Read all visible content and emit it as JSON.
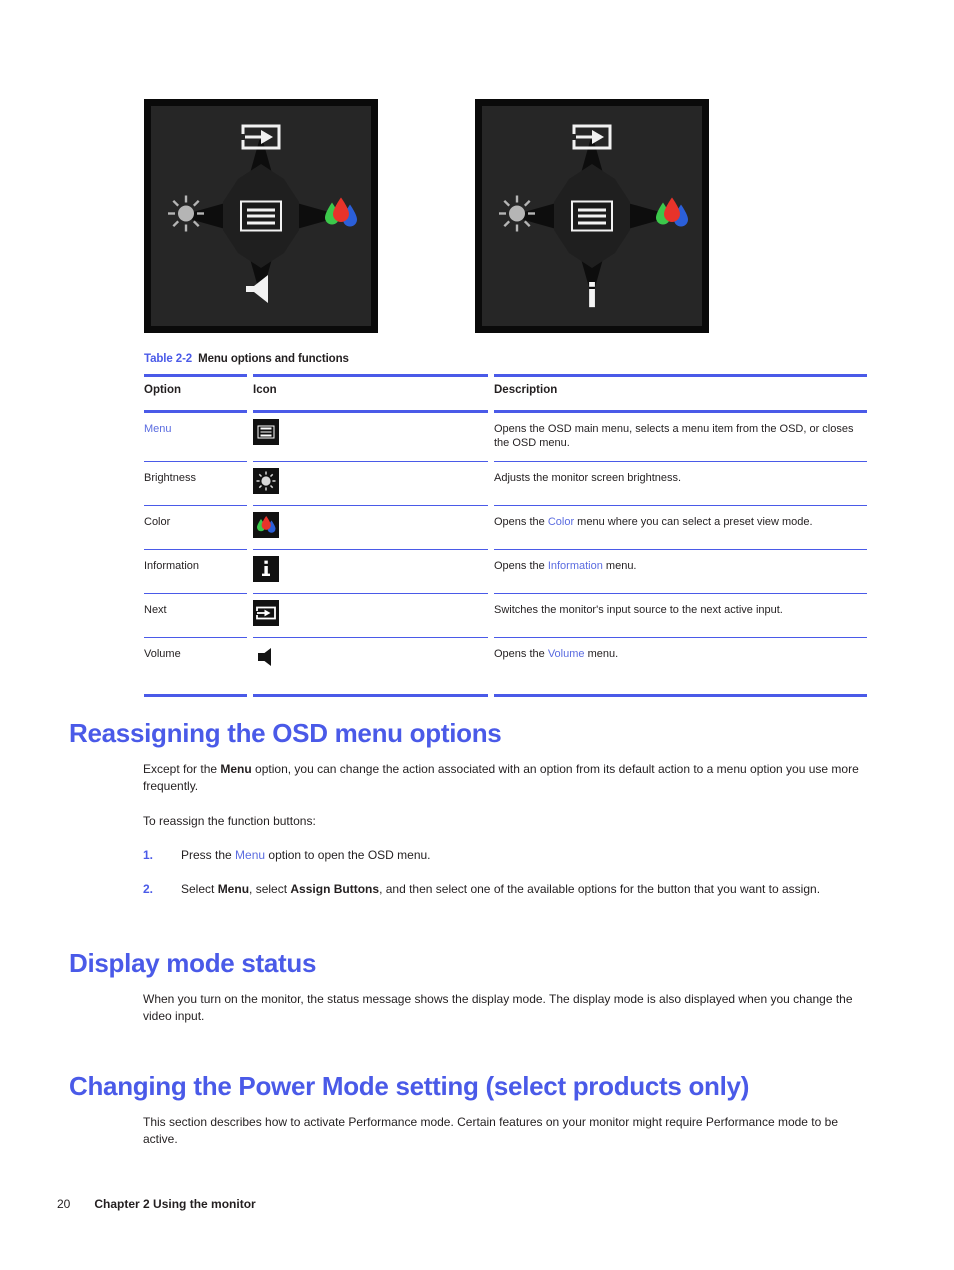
{
  "figures": {
    "left_panel": {
      "name": "osd-buttons-volume-variant",
      "top_icon": "next-input-icon",
      "left_icon": "brightness-icon",
      "center_icon": "menu-icon",
      "right_icon": "color-icon",
      "bottom_icon": "volume-icon",
      "bottom_glyph": ""
    },
    "right_panel": {
      "name": "osd-buttons-information-variant",
      "top_icon": "next-input-icon",
      "left_icon": "brightness-icon",
      "center_icon": "menu-icon",
      "right_icon": "color-icon",
      "bottom_icon": "information-icon",
      "bottom_glyph": "i"
    }
  },
  "table": {
    "caption_number": "Table 2-2",
    "caption_title": "Menu options and functions",
    "headers": [
      "Option",
      "Icon",
      "Description"
    ],
    "rows": [
      {
        "option": "Menu",
        "option_is_link": true,
        "icon": "menu-icon",
        "description_pre": "Opens the OSD main menu, selects a menu item from the OSD, or closes the OSD menu.",
        "description_link": "",
        "description_post": ""
      },
      {
        "option": "Brightness",
        "option_is_link": false,
        "icon": "brightness-icon",
        "description_pre": "Adjusts the monitor screen brightness.",
        "description_link": "",
        "description_post": ""
      },
      {
        "option": "Color",
        "option_is_link": false,
        "icon": "color-icon",
        "description_pre": "Opens the ",
        "description_link": "Color",
        "description_post": " menu where you can select a preset view mode."
      },
      {
        "option": "Information",
        "option_is_link": false,
        "icon": "information-icon",
        "description_pre": "Opens the ",
        "description_link": "Information",
        "description_post": " menu."
      },
      {
        "option": "Next",
        "option_is_link": false,
        "icon": "next-input-icon",
        "description_pre": "Switches the monitor's input source to the next active input.",
        "description_link": "",
        "description_post": ""
      },
      {
        "option": "Volume",
        "option_is_link": false,
        "icon": "volume-icon",
        "description_pre": "Opens the ",
        "description_link": "Volume",
        "description_post": " menu."
      }
    ]
  },
  "sections": {
    "reassigning": {
      "heading": "Reassigning the OSD menu options",
      "para1_a": "Except for the ",
      "para1_bold": "Menu",
      "para1_b": " option, you can change the action associated with an option from its default action to a menu option you use more frequently.",
      "para2": "To reassign the function buttons:",
      "steps": [
        {
          "num": "1.",
          "a": "Press the ",
          "link": "Menu",
          "b": " option to open the OSD menu.",
          "bold1": "",
          "c": "",
          "bold2": "",
          "d": ""
        },
        {
          "num": "2.",
          "a": "Select ",
          "link": "",
          "b": "",
          "bold1": "Menu",
          "c": ", select ",
          "bold2": "Assign Buttons",
          "d": ", and then select one of the available options for the button that you want to assign."
        }
      ]
    },
    "display_mode": {
      "heading": "Display mode status",
      "para1": "When you turn on the monitor, the status message shows the display mode. The display mode is also displayed when you change the video input."
    },
    "power_mode": {
      "heading": "Changing the Power Mode setting (select products only)",
      "para1": "This section describes how to activate Performance mode. Certain features on your monitor might require Performance mode to be active."
    }
  },
  "footer": {
    "page_number": "20",
    "chapter": "Chapter 2  Using the monitor"
  },
  "colors": {
    "heading_blue": "#4a5ae8",
    "link_blue": "#5b6ce0",
    "rule_blue": "#4a5ae8",
    "text_black": "#231f20",
    "panel_bg": "#262626",
    "panel_border": "#0a0a0a",
    "star_black": "#0d0d0d",
    "drop_red": "#e8332a",
    "drop_green": "#3cc84b",
    "drop_blue": "#2b5fd9"
  }
}
